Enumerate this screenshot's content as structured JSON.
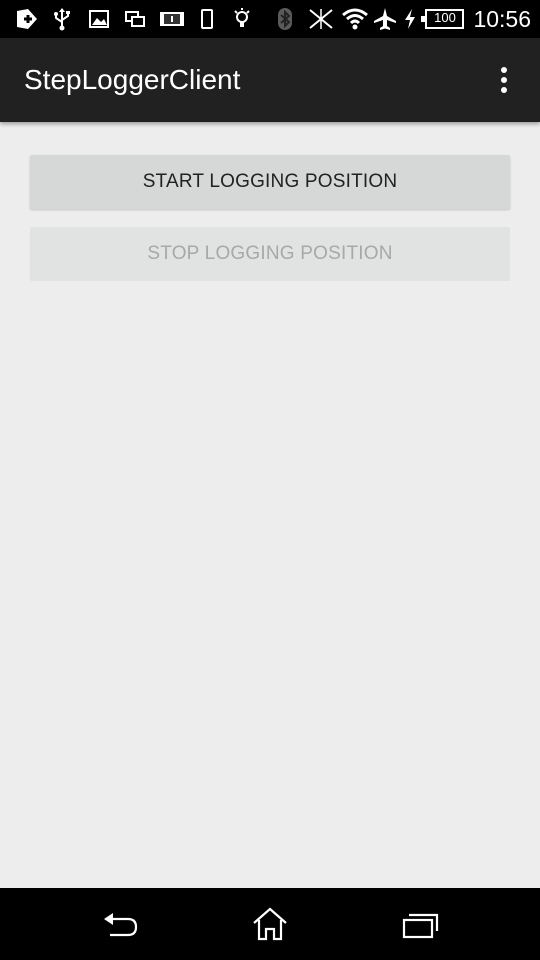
{
  "status_bar": {
    "time": "10:56",
    "battery_level": "100",
    "icons": [
      "add-box-icon",
      "usb-icon",
      "image-icon",
      "screen-mirror-icon",
      "info-card-icon",
      "phone-icon",
      "bulb-icon",
      "bluetooth-icon",
      "no-signal-icon",
      "wifi-icon",
      "airplane-icon",
      "charging-icon",
      "battery-icon"
    ]
  },
  "app_bar": {
    "title": "StepLoggerClient",
    "overflow_icon": "more-vert-icon"
  },
  "main": {
    "start_button_label": "START LOGGING POSITION",
    "stop_button_label": "STOP LOGGING POSITION",
    "stop_button_enabled": false
  },
  "nav_bar": {
    "icons": [
      "back-icon",
      "home-icon",
      "recents-icon"
    ]
  },
  "colors": {
    "status_bar_bg": "#000000",
    "app_bar_bg": "#212121",
    "content_bg": "#ededed",
    "button_bg": "#d6d7d7",
    "disabled_text": "#a8a8a8"
  }
}
